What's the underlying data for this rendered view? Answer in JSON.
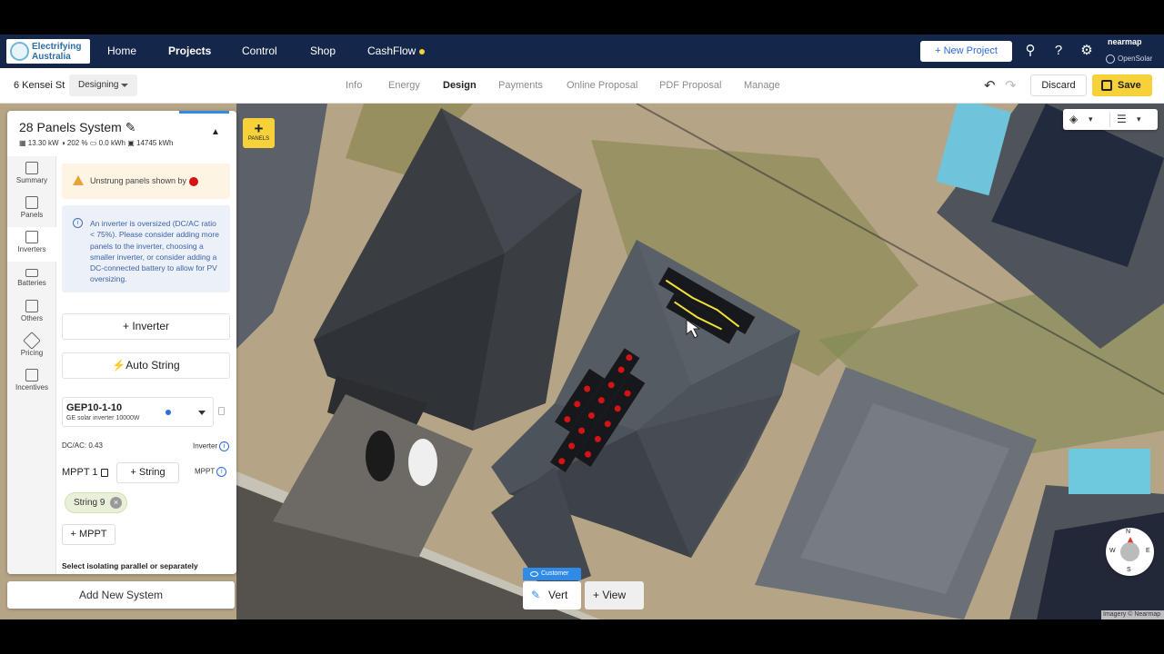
{
  "topnav": {
    "logo_line1": "Electrifying",
    "logo_line2": "Australia",
    "items": [
      {
        "label": "Home"
      },
      {
        "label": "Projects"
      },
      {
        "label": "Control"
      },
      {
        "label": "Shop"
      },
      {
        "label": "CashFlow"
      }
    ],
    "new_project": "New Project",
    "brand1": "nearmap",
    "brand2": "OpenSolar"
  },
  "subnav": {
    "address": "6 Kensei St",
    "status": "Designing",
    "tabs": [
      {
        "label": "Info"
      },
      {
        "label": "Energy"
      },
      {
        "label": "Design"
      },
      {
        "label": "Payments"
      },
      {
        "label": "Online Proposal"
      },
      {
        "label": "PDF Proposal"
      },
      {
        "label": "Manage"
      }
    ],
    "discard": "Discard",
    "save": "Save"
  },
  "panel": {
    "title": "28 Panels System",
    "stats": {
      "kw": "13.30 kW",
      "offset": "202 %",
      "battery": "0.0 kWh",
      "energy": "14745 kWh"
    },
    "sidebar": [
      {
        "label": "Summary"
      },
      {
        "label": "Panels"
      },
      {
        "label": "Inverters"
      },
      {
        "label": "Batteries"
      },
      {
        "label": "Others"
      },
      {
        "label": "Pricing"
      },
      {
        "label": "Incentives"
      }
    ],
    "warning": "Unstrung panels shown by",
    "info": "An inverter is oversized (DC/AC ratio < 75%). Please consider adding more panels to the inverter, choosing a smaller inverter, or consider adding a DC-connected battery to allow for PV oversizing.",
    "add_inverter": "Inverter",
    "auto_string": "Auto String",
    "inverter": {
      "name": "GEP10-1-10",
      "desc": "GE solar inverter 10000W"
    },
    "dcac": "DC/AC: 0.43",
    "inverter_label": "Inverter",
    "mppt_name": "MPPT 1",
    "add_string": "String",
    "mppt_label": "MPPT",
    "string_chip": "String 9",
    "add_mppt": "+ MPPT",
    "select_iso": "Select isolating parallel or separately",
    "add_system": "Add New System"
  },
  "map": {
    "panels_button": "PANELS",
    "customer": "Customer",
    "vert": "Vert",
    "view": "View",
    "compass": {
      "n": "N",
      "s": "S",
      "e": "E",
      "w": "W"
    },
    "imagery": "Imagery © Nearmap"
  },
  "colors": {
    "nav_bg": "#14274a",
    "save_yellow": "#f7d13a",
    "unstrung_red": "#d21414",
    "string_yellow": "#f3e03a"
  }
}
